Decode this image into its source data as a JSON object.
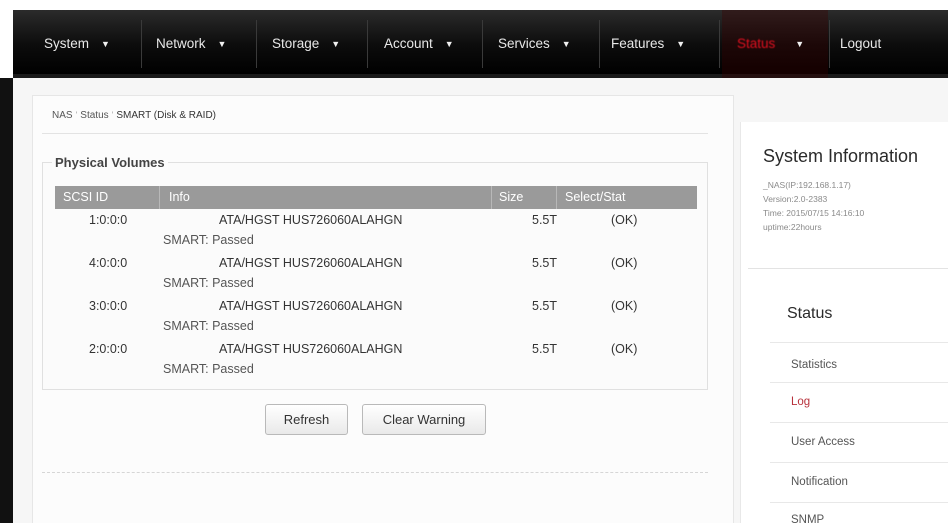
{
  "nav": {
    "items": [
      {
        "label": "System"
      },
      {
        "label": "Network"
      },
      {
        "label": "Storage"
      },
      {
        "label": "Account"
      },
      {
        "label": "Services"
      },
      {
        "label": "Features"
      },
      {
        "label": "Status"
      },
      {
        "label": "Logout"
      }
    ],
    "active_color": "#e01020"
  },
  "breadcrumb": {
    "items": [
      "NAS",
      "Status",
      "SMART (Disk & RAID)"
    ],
    "separator": "'"
  },
  "volumes": {
    "legend": "Physical Volumes",
    "columns": [
      "SCSI ID",
      "Info",
      "Size",
      "Select/Stat"
    ],
    "rows": [
      {
        "scsi_id": "1:0:0:0",
        "info": "ATA/HGST HUS726060ALAHGN",
        "size": "5.5T",
        "status": "(OK)",
        "smart": "SMART: Passed"
      },
      {
        "scsi_id": "4:0:0:0",
        "info": "ATA/HGST HUS726060ALAHGN",
        "size": "5.5T",
        "status": "(OK)",
        "smart": "SMART: Passed"
      },
      {
        "scsi_id": "3:0:0:0",
        "info": "ATA/HGST HUS726060ALAHGN",
        "size": "5.5T",
        "status": "(OK)",
        "smart": "SMART: Passed"
      },
      {
        "scsi_id": "2:0:0:0",
        "info": "ATA/HGST HUS726060ALAHGN",
        "size": "5.5T",
        "status": "(OK)",
        "smart": "SMART: Passed"
      }
    ]
  },
  "buttons": {
    "refresh": "Refresh",
    "clear_warning": "Clear Warning"
  },
  "system_info": {
    "title": "System Information",
    "lines": [
      "_NAS(IP:192.168.1.17)",
      "Version:2.0-2383",
      "Time: 2015/07/15 14:16:10",
      "uptime:22hours"
    ]
  },
  "status_menu": {
    "title": "Status",
    "items": [
      "Statistics",
      "Log",
      "User Access",
      "Notification",
      "SNMP"
    ],
    "active_index": 1,
    "active_color": "#b8323c"
  }
}
